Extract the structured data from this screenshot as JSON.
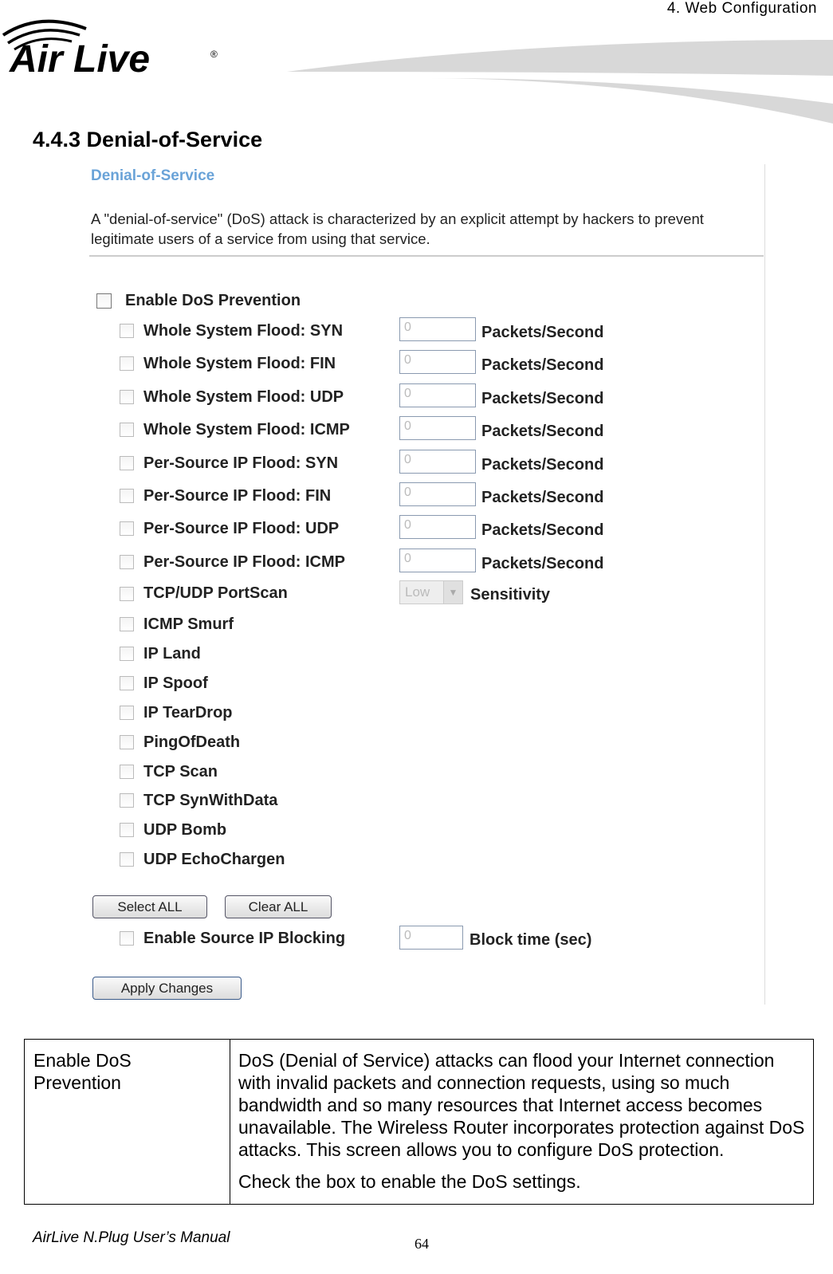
{
  "header": {
    "chapter": "4.  Web  Configuration",
    "logo_text": "Air Live"
  },
  "section_title": "4.4.3 Denial-of-Service",
  "screenshot": {
    "title": "Denial-of-Service",
    "description": "A \"denial-of-service\" (DoS) attack is characterized by an explicit attempt by hackers to prevent legitimate users of a service from using that service.",
    "enable_label": "Enable DoS Prevention",
    "enable_checked": false,
    "flood_rows": [
      {
        "label": "Whole System Flood: SYN",
        "value": "0",
        "unit": "Packets/Second"
      },
      {
        "label": "Whole System Flood: FIN",
        "value": "0",
        "unit": "Packets/Second"
      },
      {
        "label": "Whole System Flood: UDP",
        "value": "0",
        "unit": "Packets/Second"
      },
      {
        "label": "Whole System Flood: ICMP",
        "value": "0",
        "unit": "Packets/Second"
      },
      {
        "label": "Per-Source IP Flood: SYN",
        "value": "0",
        "unit": "Packets/Second"
      },
      {
        "label": "Per-Source IP Flood: FIN",
        "value": "0",
        "unit": "Packets/Second"
      },
      {
        "label": "Per-Source IP Flood: UDP",
        "value": "0",
        "unit": "Packets/Second"
      },
      {
        "label": "Per-Source IP Flood: ICMP",
        "value": "0",
        "unit": "Packets/Second"
      }
    ],
    "portscan": {
      "label": "TCP/UDP PortScan",
      "select_value": "Low",
      "unit": "Sensitivity"
    },
    "simple_rows": [
      "ICMP Smurf",
      "IP Land",
      "IP Spoof",
      "IP TearDrop",
      "PingOfDeath",
      "TCP Scan",
      "TCP SynWithData",
      "UDP Bomb",
      "UDP EchoChargen"
    ],
    "select_all": "Select ALL",
    "clear_all": "Clear ALL",
    "source_block": {
      "label": "Enable Source IP Blocking",
      "value": "0",
      "unit": "Block time (sec)"
    },
    "apply": "Apply Changes"
  },
  "table": {
    "term": "Enable DoS Prevention",
    "desc1": "DoS (Denial of Service) attacks can flood your Internet connection with invalid packets and connection requests, using so much bandwidth and so many resources that Internet access becomes unavailable. The Wireless Router incorporates protection against DoS attacks. This screen allows you to configure DoS protection.",
    "desc2": "Check the box to enable the DoS settings."
  },
  "footer": {
    "manual": "AirLive N.Plug User’s Manual",
    "page": "64"
  }
}
